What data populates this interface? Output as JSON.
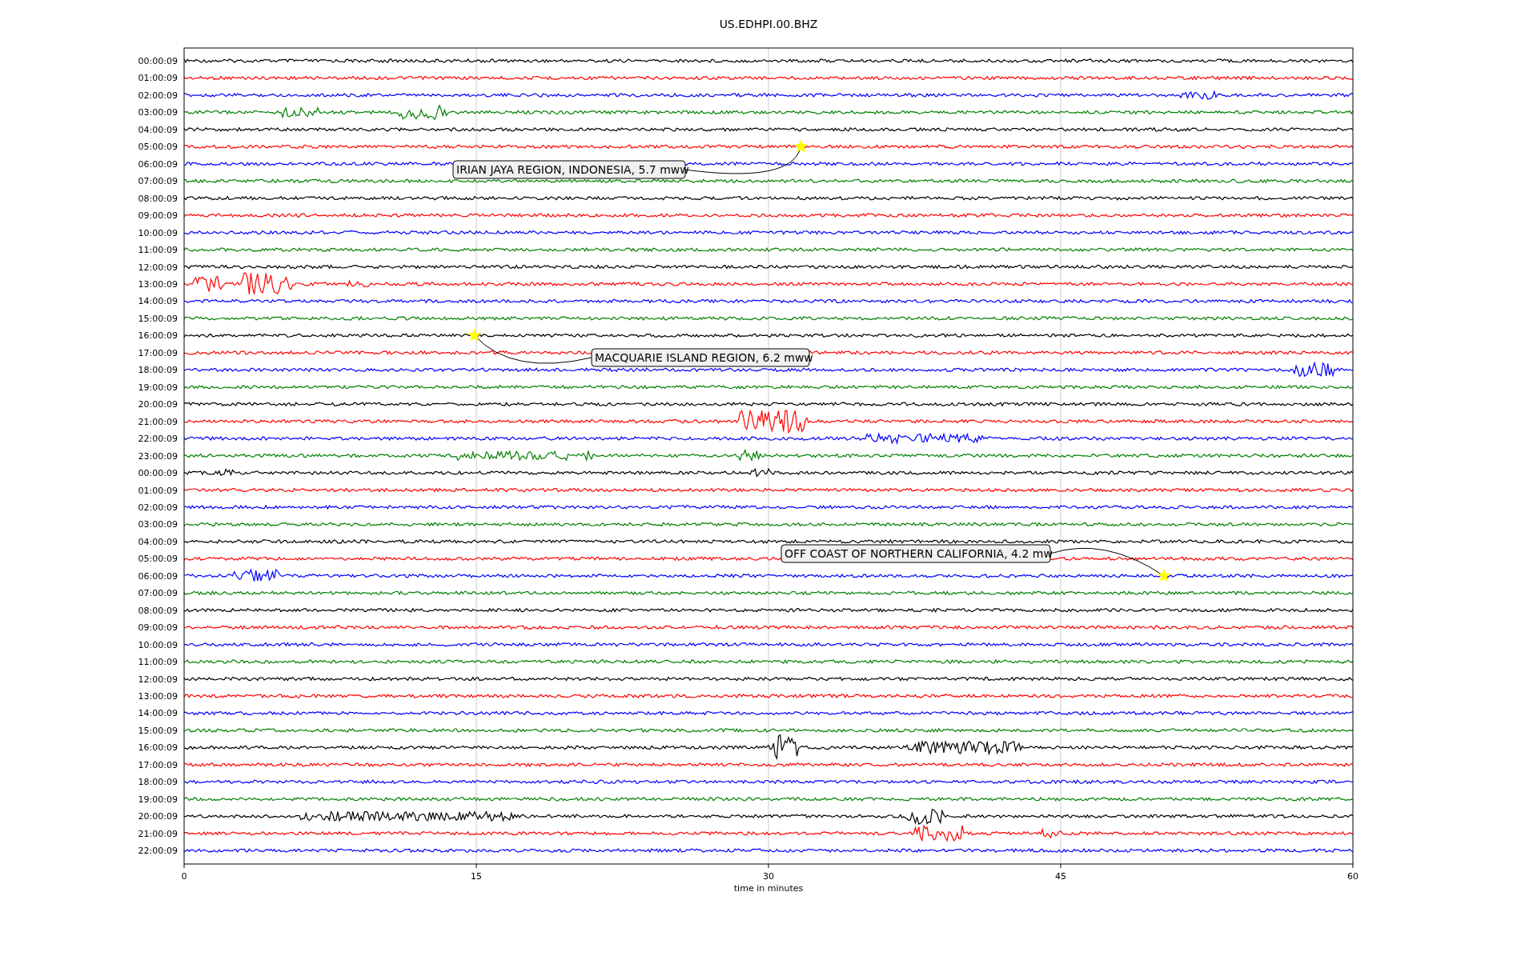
{
  "title": "US.EDHPI.00.BHZ",
  "rows": [
    {
      "label": "00:00:09",
      "color": "#000000"
    },
    {
      "label": "01:00:09",
      "color": "#ff0000"
    },
    {
      "label": "02:00:09",
      "color": "#0000ff"
    },
    {
      "label": "03:00:09",
      "color": "#008000"
    },
    {
      "label": "04:00:09",
      "color": "#000000"
    },
    {
      "label": "05:00:09",
      "color": "#ff0000"
    },
    {
      "label": "06:00:09",
      "color": "#0000ff"
    },
    {
      "label": "07:00:09",
      "color": "#008000"
    },
    {
      "label": "08:00:09",
      "color": "#000000"
    },
    {
      "label": "09:00:09",
      "color": "#ff0000"
    },
    {
      "label": "10:00:09",
      "color": "#0000ff"
    },
    {
      "label": "11:00:09",
      "color": "#008000"
    },
    {
      "label": "12:00:09",
      "color": "#000000"
    },
    {
      "label": "13:00:09",
      "color": "#ff0000"
    },
    {
      "label": "14:00:09",
      "color": "#0000ff"
    },
    {
      "label": "15:00:09",
      "color": "#008000"
    },
    {
      "label": "16:00:09",
      "color": "#000000"
    },
    {
      "label": "17:00:09",
      "color": "#ff0000"
    },
    {
      "label": "18:00:09",
      "color": "#0000ff"
    },
    {
      "label": "19:00:09",
      "color": "#008000"
    },
    {
      "label": "20:00:09",
      "color": "#000000"
    },
    {
      "label": "21:00:09",
      "color": "#ff0000"
    },
    {
      "label": "22:00:09",
      "color": "#0000ff"
    },
    {
      "label": "23:00:09",
      "color": "#008000"
    },
    {
      "label": "00:00:09",
      "color": "#000000"
    },
    {
      "label": "01:00:09",
      "color": "#ff0000"
    },
    {
      "label": "02:00:09",
      "color": "#0000ff"
    },
    {
      "label": "03:00:09",
      "color": "#008000"
    },
    {
      "label": "04:00:09",
      "color": "#000000"
    },
    {
      "label": "05:00:09",
      "color": "#ff0000"
    },
    {
      "label": "06:00:09",
      "color": "#0000ff"
    },
    {
      "label": "07:00:09",
      "color": "#008000"
    },
    {
      "label": "08:00:09",
      "color": "#000000"
    },
    {
      "label": "09:00:09",
      "color": "#ff0000"
    },
    {
      "label": "10:00:09",
      "color": "#0000ff"
    },
    {
      "label": "11:00:09",
      "color": "#008000"
    },
    {
      "label": "12:00:09",
      "color": "#000000"
    },
    {
      "label": "13:00:09",
      "color": "#ff0000"
    },
    {
      "label": "14:00:09",
      "color": "#0000ff"
    },
    {
      "label": "15:00:09",
      "color": "#008000"
    },
    {
      "label": "16:00:09",
      "color": "#000000"
    },
    {
      "label": "17:00:09",
      "color": "#ff0000"
    },
    {
      "label": "18:00:09",
      "color": "#0000ff"
    },
    {
      "label": "19:00:09",
      "color": "#008000"
    },
    {
      "label": "20:00:09",
      "color": "#000000"
    },
    {
      "label": "21:00:09",
      "color": "#ff0000"
    },
    {
      "label": "22:00:09",
      "color": "#0000ff"
    }
  ],
  "x_ticks": [
    "0",
    "15",
    "30",
    "45",
    "60"
  ],
  "x_label": "time in minutes",
  "events": [
    {
      "text": "IRIAN JAYA REGION, INDONESIA, 5.7 mww"
    },
    {
      "text": "MACQUARIE ISLAND REGION, 6.2 mww"
    },
    {
      "text": "OFF COAST OF NORTHERN CALIFORNIA, 4.2 mw"
    }
  ]
}
